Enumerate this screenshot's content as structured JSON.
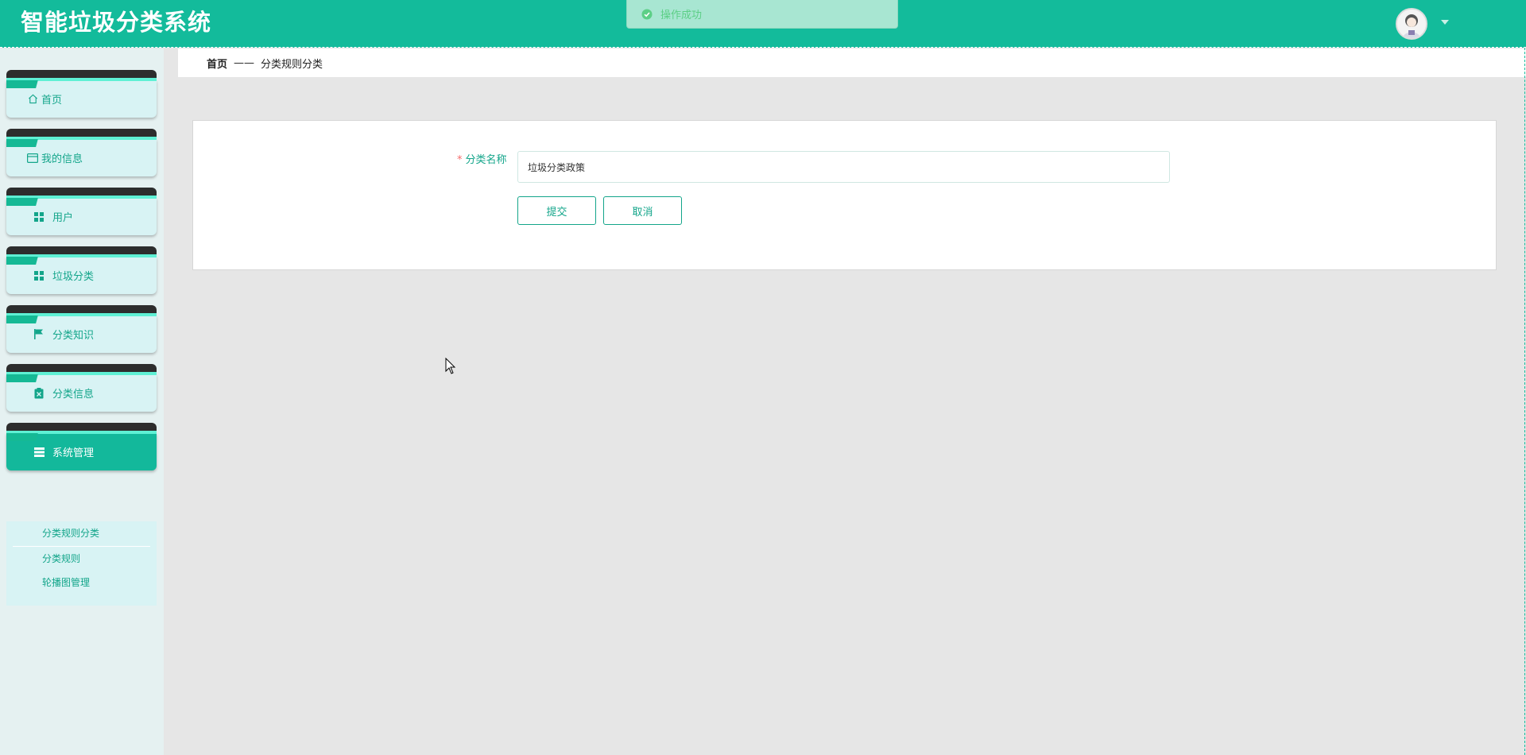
{
  "app": {
    "title": "智能垃圾分类系统"
  },
  "toast": {
    "message": "操作成功",
    "icon": "check-circle-icon",
    "color": "#5ccf86"
  },
  "user": {
    "avatar_icon": "user-avatar",
    "menu_caret_icon": "caret-down-icon"
  },
  "sidebar": {
    "items": [
      {
        "label": "首页",
        "icon": "home-icon"
      },
      {
        "label": "我的信息",
        "icon": "card-icon"
      },
      {
        "label": "用户",
        "icon": "grid-icon"
      },
      {
        "label": "垃圾分类",
        "icon": "grid-icon"
      },
      {
        "label": "分类知识",
        "icon": "flag-icon"
      },
      {
        "label": "分类信息",
        "icon": "clipboard-icon"
      },
      {
        "label": "系统管理",
        "icon": "list-icon",
        "active": true
      }
    ],
    "submenu": [
      {
        "label": "分类规则分类"
      },
      {
        "label": "分类规则"
      },
      {
        "label": "轮播图管理"
      }
    ]
  },
  "breadcrumb": {
    "home": "首页",
    "separator": "——",
    "current": "分类规则分类"
  },
  "form": {
    "field_label": "分类名称",
    "required_mark": "*",
    "field_value": "垃圾分类政策",
    "submit_label": "提交",
    "cancel_label": "取消"
  },
  "colors": {
    "header": "#13bb9b",
    "accent": "#13a58a",
    "sidebar_bg": "#e5f1f1",
    "menu_bg": "#d8f3f4",
    "page_bg": "#e6e6e6"
  }
}
